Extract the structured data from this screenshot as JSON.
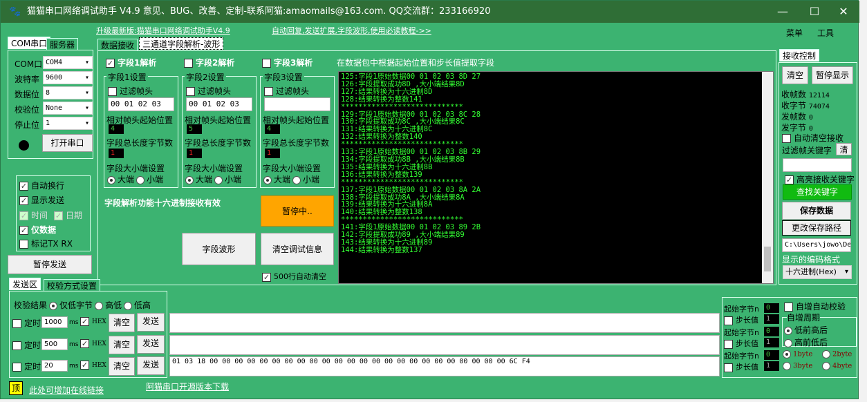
{
  "window": {
    "title": "猫猫串口网络调试助手 V4.9 意见、BUG、改善、定制-联系阿猫:amaomails@163.com. QQ交流群：233166920",
    "min": "—",
    "max": "☐",
    "close": "✕"
  },
  "links": {
    "upgrade": "升级最新版:猫猫串口网络调试助手V4.9",
    "tutorial": "自动回复,发送扩展,字段波形,使用必读教程->>",
    "online": "此处可增加在线链接",
    "opensource": "阿猫串口开源版本下载"
  },
  "menu": {
    "menu": "菜单",
    "tools": "工具"
  },
  "left": {
    "tabs": [
      "COM串口",
      "服务器"
    ],
    "rows": [
      {
        "label": "COM口",
        "value": "COM4"
      },
      {
        "label": "波特率",
        "value": "9600"
      },
      {
        "label": "数据位",
        "value": "8"
      },
      {
        "label": "校验位",
        "value": "None"
      },
      {
        "label": "停止位",
        "value": "1"
      }
    ],
    "open_button": "打开串口",
    "options": [
      {
        "label": "自动换行",
        "checked": true
      },
      {
        "label": "显示发送",
        "checked": true
      },
      {
        "label": "仅数据",
        "checked": true
      },
      {
        "label": "标记TX RX",
        "checked": false
      }
    ],
    "time": "时间",
    "date": "日期",
    "pause_send": "暂停发送"
  },
  "center": {
    "tabs": [
      "数据接收",
      "三通道字段解析-波形"
    ],
    "hint": "在数据包中根据起始位置和步长值提取字段",
    "fields": [
      {
        "enable": "字段1解析",
        "checked": true,
        "group": "字段1设置",
        "filter": "过滤帧头",
        "header": "00 01 02 03",
        "start_label": "相对帧头起始位置",
        "start": "4",
        "len_label": "字段总长度字节数",
        "len": "1",
        "endian_label": "字段大小端设置",
        "big": "大端",
        "small": "小端"
      },
      {
        "enable": "字段2解析",
        "checked": false,
        "group": "字段2设置",
        "filter": "过滤帧头",
        "header": "00 01 02 03",
        "start_label": "相对帧头起始位置",
        "start": "5",
        "len_label": "字段总长度字节数",
        "len": "1",
        "endian_label": "字段大小端设置",
        "big": "大端",
        "small": "小端"
      },
      {
        "enable": "字段3解析",
        "checked": false,
        "group": "字段3设置",
        "filter": "过滤帧头",
        "header": "",
        "start_label": "相对帧头起始位置",
        "start": "4",
        "len_label": "字段总长度字节数",
        "len": "1",
        "endian_label": "字段大小端设置",
        "big": "大端",
        "small": "小端"
      }
    ],
    "note": "字段解析功能十六进制接收有效",
    "paused": "暂停中..",
    "wave": "字段波形",
    "clear_debug": "清空调试信息",
    "auto_clear": "500行自动清空",
    "terminal": [
      "125:字段1原始数据00 01 02 03 8D 27",
      "126:字段提取成功8D ,大小端结果8D",
      "127:结果转换为十六进制8D",
      "128:结果转换为整数141",
      "****************************",
      "129:字段1原始数据00 01 02 03 8C 28",
      "130:字段提取成功8C ,大小端结果8C",
      "131:结果转换为十六进制8C",
      "132:结果转换为整数140",
      "****************************",
      "133:字段1原始数据00 01 02 03 8B 29",
      "134:字段提取成功8B ,大小端结果8B",
      "135:结果转换为十六进制8B",
      "136:结果转换为整数139",
      "****************************",
      "137:字段1原始数据00 01 02 03 8A 2A",
      "138:字段提取成功8A ,大小端结果8A",
      "139:结果转换为十六进制8A",
      "140:结果转换为整数138",
      "****************************",
      "141:字段1原始数据00 01 02 03 89 2B",
      "142:字段提取成功89 ,大小端结果89",
      "143:结果转换为十六进制89",
      "144:结果转换为整数137"
    ]
  },
  "right": {
    "tab": "接收控制",
    "clear": "清空",
    "pause_display": "暂停显示",
    "stats": [
      {
        "label": "收帧数",
        "value": "12114"
      },
      {
        "label": "收字节",
        "value": "74074"
      },
      {
        "label": "发帧数",
        "value": "0"
      },
      {
        "label": "发字节",
        "value": "0"
      }
    ],
    "auto_clear": "自动清空接收",
    "filter_kw": "过滤帧关键字",
    "filter_clear": "清",
    "filter_value": "",
    "highlight": "高亮接收关键字",
    "find": "查找关键字",
    "save": "保存数据",
    "change_path": "更改保存路径",
    "path": "C:\\Users\\jowo\\De",
    "encoding_label": "显示的编码格式",
    "encoding": "十六进制(Hex)"
  },
  "send": {
    "tabs": [
      "发送区",
      "校验方式设置"
    ],
    "check_label": "校验结果",
    "check_opts": [
      "仅低字节",
      "高低",
      "低高"
    ],
    "rows": [
      {
        "timer": "定时",
        "ms": "1000",
        "unit": "ms",
        "hex": "HEX",
        "clear": "清空",
        "send": "发送",
        "content": ""
      },
      {
        "timer": "定时",
        "ms": "500",
        "unit": "ms",
        "hex": "HEX",
        "clear": "清空",
        "send": "发送",
        "content": ""
      },
      {
        "timer": "定时",
        "ms": "20",
        "unit": "ms",
        "hex": "HEX",
        "clear": "清空",
        "send": "发送",
        "content": "01 03 18 00 00 00 00 00 00 00 00 00 00 00 00 00 00 00 00 00 00 00 00 00 00 00 00 6C F4"
      }
    ],
    "inc": [
      {
        "start_label": "起始字节n",
        "start": "0",
        "step_label": "步长值",
        "step": "1"
      },
      {
        "start_label": "起始字节n",
        "start": "0",
        "step_label": "步长值",
        "step": "1"
      },
      {
        "start_label": "起始字节n",
        "start": "0",
        "step_label": "步长值",
        "step": "1"
      }
    ],
    "auto_check": "自增自动校验",
    "period": "自增周期",
    "low_first": "低前高后",
    "high_first": "高前低后",
    "bytes": [
      "1byte",
      "2byte",
      "3byte",
      "4byte"
    ]
  },
  "top_button": "顶",
  "colors": {
    "window": "#3cb371",
    "title": "#2f6e36",
    "terminal_text": "#33ff33",
    "paused": "#ffa500",
    "find": "#11bb11"
  }
}
